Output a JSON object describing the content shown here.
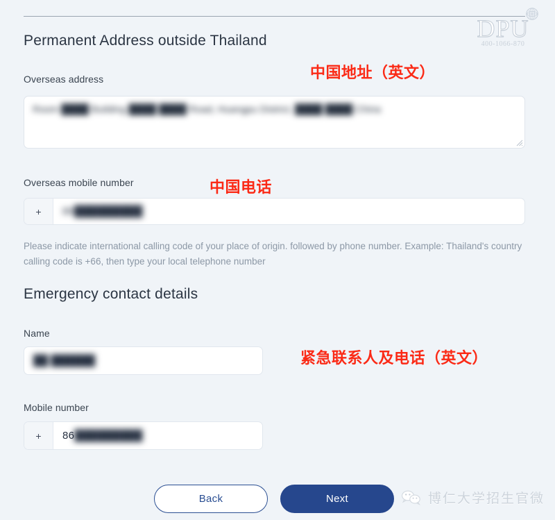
{
  "branding": {
    "logo_letters": "DPU",
    "logo_phone": "400-1066-870",
    "logo_icon": "globe-sphere-icon",
    "footer_watermark_icon": "wechat-icon",
    "footer_watermark_text": "博仁大学招生官微"
  },
  "colors": {
    "page_background": "#f0f4f8",
    "primary_blue": "#26478d",
    "annotation_red": "#fb2a16",
    "field_border": "#e1e7ee",
    "help_text": "#8c98a6",
    "heading": "#2b3543"
  },
  "sections": {
    "permanent_address": {
      "title": "Permanent Address outside Thailand",
      "annotation": "中国地址（英文）",
      "overseas_address": {
        "label": "Overseas address",
        "value": "Room ████ Building ████ ████ Road, Huangpu District, ████ ████ China",
        "redacted": true
      },
      "overseas_mobile": {
        "label": "Overseas mobile number",
        "annotation": "中国电话",
        "prefix": "+",
        "value": "86█████████",
        "value_visible": "",
        "redacted": true
      },
      "help_text": "Please indicate international calling code of your place of origin. followed by phone number. Example: Thailand's country calling code is +66, then type your local telephone number"
    },
    "emergency_contact": {
      "title": "Emergency contact details",
      "annotation": "紧急联系人及电话（英文）",
      "name": {
        "label": "Name",
        "value": "██ ██████",
        "redacted": true
      },
      "mobile": {
        "label": "Mobile number",
        "prefix": "+",
        "value_visible": "86",
        "value_redacted": "█████████",
        "redacted": true
      }
    }
  },
  "footer": {
    "back_label": "Back",
    "next_label": "Next"
  }
}
